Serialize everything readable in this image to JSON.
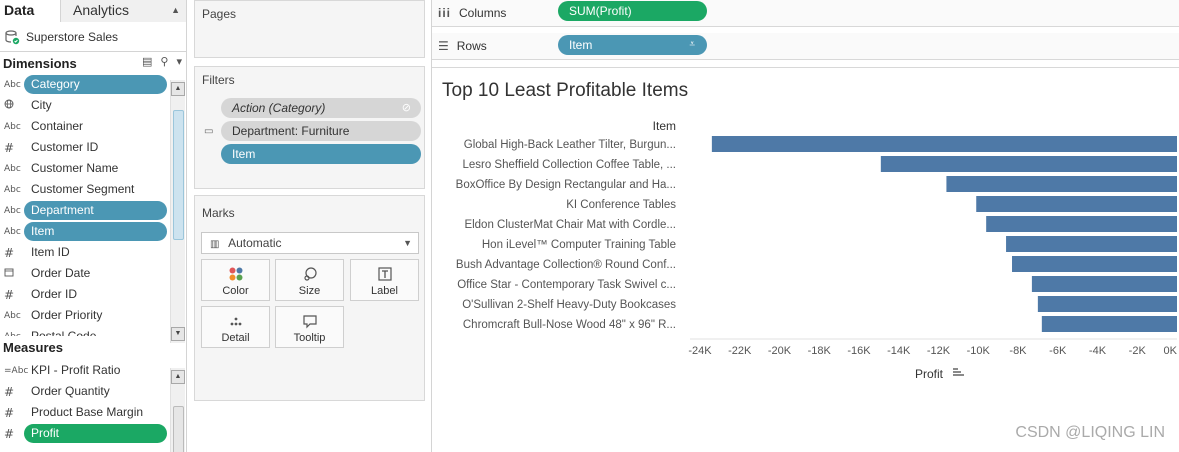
{
  "data_pane": {
    "tabs": [
      {
        "label": "Data",
        "active": true,
        "icon": null
      },
      {
        "label": "Analytics",
        "active": false,
        "icon": "updown-arrow-icon"
      }
    ],
    "datasource": {
      "name": "Superstore Sales",
      "icon": "database-icon"
    },
    "dimensions": {
      "title": "Dimensions",
      "fields": [
        {
          "type": "Abc",
          "name": "Category",
          "selected": "blue"
        },
        {
          "type": "globe",
          "name": "City",
          "selected": ""
        },
        {
          "type": "Abc",
          "name": "Container",
          "selected": ""
        },
        {
          "type": "#",
          "name": "Customer ID",
          "selected": ""
        },
        {
          "type": "Abc",
          "name": "Customer Name",
          "selected": ""
        },
        {
          "type": "Abc",
          "name": "Customer Segment",
          "selected": ""
        },
        {
          "type": "Abc",
          "name": "Department",
          "selected": "blue"
        },
        {
          "type": "Abc",
          "name": "Item",
          "selected": "blue"
        },
        {
          "type": "#",
          "name": "Item ID",
          "selected": ""
        },
        {
          "type": "cal",
          "name": "Order Date",
          "selected": ""
        },
        {
          "type": "#",
          "name": "Order ID",
          "selected": ""
        },
        {
          "type": "Abc",
          "name": "Order Priority",
          "selected": ""
        },
        {
          "type": "Abc",
          "name": "Postal Code",
          "selected": ""
        }
      ]
    },
    "measures": {
      "title": "Measures",
      "fields": [
        {
          "type": "=Abc",
          "name": "KPI - Profit Ratio",
          "selected": ""
        },
        {
          "type": "#",
          "name": "Order Quantity",
          "selected": ""
        },
        {
          "type": "#",
          "name": "Product Base Margin",
          "selected": ""
        },
        {
          "type": "#",
          "name": "Profit",
          "selected": "green"
        }
      ]
    }
  },
  "pages_card": {
    "title": "Pages"
  },
  "filters_card": {
    "title": "Filters",
    "pills": [
      {
        "label": "Action (Category)",
        "style": "grey",
        "italic": true
      },
      {
        "label": "Department: Furniture",
        "style": "grey",
        "italic": false
      },
      {
        "label": "Item",
        "style": "blue",
        "italic": false
      }
    ]
  },
  "marks_card": {
    "title": "Marks",
    "mark_type": "Automatic",
    "buttons": [
      {
        "label": "Color",
        "icon": "color-dots-icon"
      },
      {
        "label": "Size",
        "icon": "size-icon"
      },
      {
        "label": "Label",
        "icon": "label-icon"
      },
      {
        "label": "Detail",
        "icon": "detail-icon"
      },
      {
        "label": "Tooltip",
        "icon": "tooltip-icon"
      }
    ]
  },
  "columns_shelf": {
    "label": "Columns",
    "pill": "SUM(Profit)",
    "icon": "columns-icon"
  },
  "rows_shelf": {
    "label": "Rows",
    "pill": "Item",
    "icon": "rows-icon"
  },
  "watermark": "CSDN @LIQING LIN",
  "chart_data": {
    "type": "bar",
    "orientation": "horizontal",
    "title": "Top 10 Least Profitable Items",
    "row_header": "Item",
    "xlabel": "Profit",
    "categories": [
      "Global High-Back Leather Tilter, Burgun...",
      "Lesro Sheffield Collection Coffee Table, ...",
      "BoxOffice By Design Rectangular and Ha...",
      "KI Conference Tables",
      "Eldon ClusterMat Chair Mat with Cordle...",
      "Hon iLevel™ Computer Training Table",
      "Bush Advantage Collection® Round Conf...",
      "Office Star - Contemporary Task Swivel c...",
      "O'Sullivan 2-Shelf Heavy-Duty Bookcases",
      "Chromcraft Bull-Nose Wood 48\" x 96\" R..."
    ],
    "values": [
      -23400,
      -14900,
      -11600,
      -10100,
      -9600,
      -8600,
      -8300,
      -7300,
      -7000,
      -6800
    ],
    "xlim": [
      -24500,
      0
    ],
    "xticks": [
      -24000,
      -22000,
      -20000,
      -18000,
      -16000,
      -14000,
      -12000,
      -10000,
      -8000,
      -6000,
      -4000,
      -2000,
      0
    ],
    "xtick_labels": [
      "-24K",
      "-22K",
      "-20K",
      "-18K",
      "-16K",
      "-14K",
      "-12K",
      "-10K",
      "-8K",
      "-6K",
      "-4K",
      "-2K",
      "0K"
    ],
    "bar_color": "#4e79a7",
    "grid": false
  }
}
